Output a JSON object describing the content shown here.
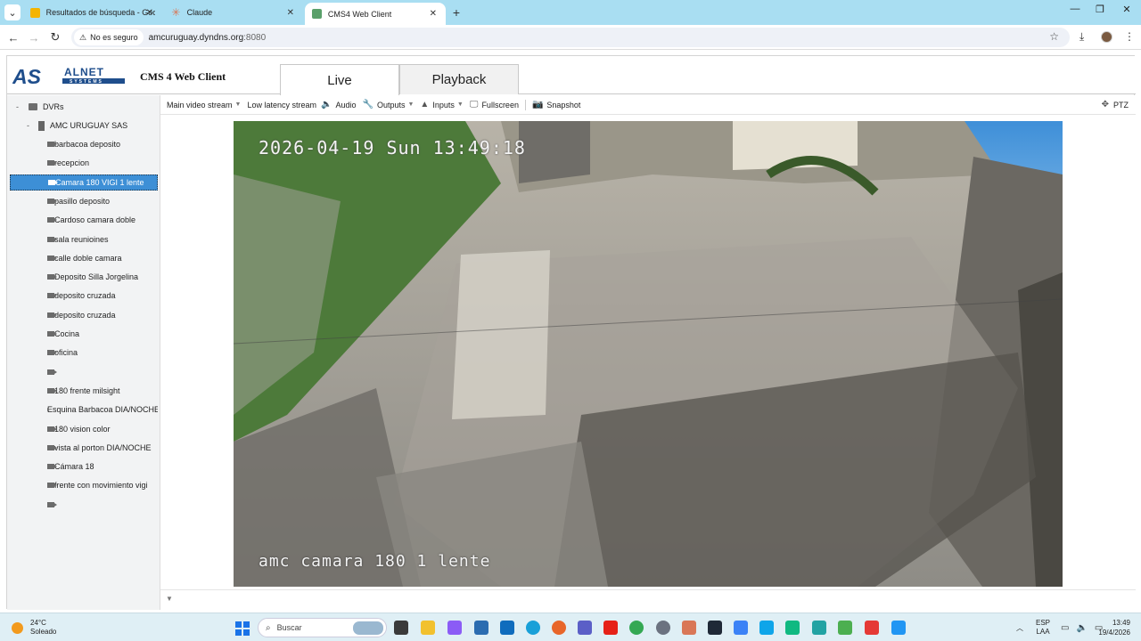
{
  "browser": {
    "tabs": [
      {
        "title": "Resultados de búsqueda - Google",
        "favicon": "google-drive-icon",
        "active": false
      },
      {
        "title": "Claude",
        "favicon": "claude-icon",
        "active": false
      },
      {
        "title": "CMS4 Web Client",
        "favicon": "cms-icon",
        "active": true
      }
    ],
    "new_tab_label": "+",
    "security_label": "No es seguro",
    "url_host": "amcuruguay.dyndns.org",
    "url_port": ":8080"
  },
  "app": {
    "logo_text": "AS ALNET SYSTEMS",
    "title": "CMS 4 Web Client",
    "tabs": {
      "live": "Live",
      "playback": "Playback"
    }
  },
  "tree": {
    "root": "DVRs",
    "dvr": "AMC URUGUAY SAS",
    "cameras": [
      "barbacoa deposito",
      "recepcion",
      "Camara 180 VIGI 1 lente",
      "pasillo deposito",
      "Cardoso camara doble",
      "sala reunioines",
      "calle doble camara",
      "Deposito Silla Jorgelina",
      "deposito cruzada",
      "deposito cruzada",
      "Cocina",
      "oficina",
      "",
      "180 frente milsight",
      "Esquina Barbacoa DIA/NOCHE",
      "180 vision color",
      "vista al porton DIA/NOCHE",
      "Cámara 18",
      "frente con movimiento vigi",
      ""
    ],
    "selected_index": 2
  },
  "video_toolbar": {
    "main_stream": "Main video stream",
    "low_latency": "Low latency stream",
    "audio": "Audio",
    "outputs": "Outputs",
    "inputs": "Inputs",
    "fullscreen": "Fullscreen",
    "snapshot": "Snapshot",
    "ptz": "PTZ"
  },
  "video": {
    "osd_time": "2026-04-19 Sun 13:49:18",
    "osd_name": "amc camara 180 1 lente"
  },
  "taskbar": {
    "temperature": "24°C",
    "weather": "Soleado",
    "search_placeholder": "Buscar",
    "lang_top": "ESP",
    "lang_bottom": "LAA",
    "time": "13:49",
    "date": "19/4/2026"
  },
  "colors": {
    "tabstrip": "#a9def2",
    "selection": "#3d8fd6",
    "logo_blue": "#1f4e8c",
    "taskbar": "#dfeff5"
  }
}
